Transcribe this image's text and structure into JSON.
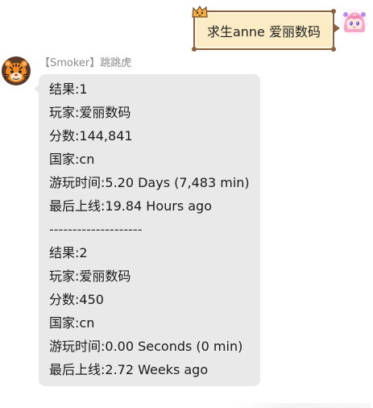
{
  "outgoing": {
    "text": "求生anne 爱丽数码"
  },
  "incoming": {
    "sender": "【Smoker】跳跳虎",
    "lines": [
      "结果:1",
      "玩家:爱丽数码",
      "分数:144,841",
      "国家:cn",
      "游玩时间:5.20 Days (7,483 min)",
      "最后上线:19.84 Hours ago",
      "--------------------",
      "结果:2",
      "玩家:爱丽数码",
      "分数:450",
      "国家:cn",
      "游玩时间:0.00 Seconds (0 min)",
      "最后上线:2.72 Weeks ago"
    ]
  },
  "icons": {
    "sender_avatar": "tiger-avatar-icon",
    "self_avatar": "anime-girl-avatar-icon",
    "sticker_decoration": "cat-sticker-icon"
  },
  "colors": {
    "bubble_in": "#e9e9e9",
    "bubble_out_fill": "#fbecc6",
    "bubble_out_border": "#8a6242",
    "sender_name": "#8a8a8a"
  }
}
